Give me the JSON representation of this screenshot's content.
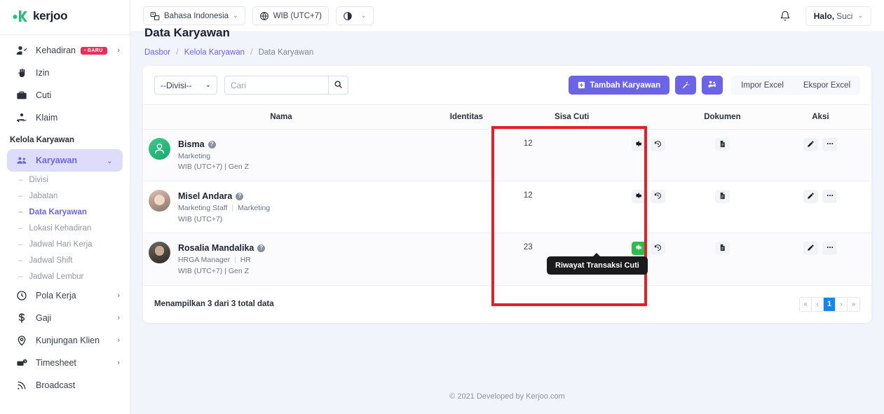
{
  "brand": {
    "name": "kerjoo",
    "accent": "#6b63e8",
    "logo_icon": "kerjoo-leaf-logo"
  },
  "sidebar": {
    "top_items": [
      {
        "label": "Kehadiran",
        "icon": "user-check-icon",
        "badge": "BARU",
        "chevron": "›"
      },
      {
        "label": "Izin",
        "icon": "hand-icon",
        "badge": "",
        "chevron": ""
      },
      {
        "label": "Cuti",
        "icon": "briefcase-icon",
        "badge": "",
        "chevron": ""
      },
      {
        "label": "Klaim",
        "icon": "hand-coin-icon",
        "badge": "",
        "chevron": ""
      }
    ],
    "section_title": "Kelola Karyawan",
    "active_item": {
      "label": "Karyawan",
      "icon": "people-icon",
      "chevron": "⌄"
    },
    "sub_items": [
      {
        "label": "Divisi",
        "selected": false
      },
      {
        "label": "Jabatan",
        "selected": false
      },
      {
        "label": "Data Karyawan",
        "selected": true
      },
      {
        "label": "Lokasi Kehadiran",
        "selected": false
      },
      {
        "label": "Jadwal Hari Kerja",
        "selected": false
      },
      {
        "label": "Jadwal Shift",
        "selected": false
      },
      {
        "label": "Jadwal Lembur",
        "selected": false
      }
    ],
    "bottom_items": [
      {
        "label": "Pola Kerja",
        "icon": "clock-icon",
        "chevron": "›"
      },
      {
        "label": "Gaji",
        "icon": "dollar-icon",
        "chevron": "›"
      },
      {
        "label": "Kunjungan Klien",
        "icon": "map-pin-icon",
        "chevron": "›"
      },
      {
        "label": "Timesheet",
        "icon": "timesheet-icon",
        "chevron": "›"
      },
      {
        "label": "Broadcast",
        "icon": "broadcast-icon",
        "chevron": ""
      }
    ]
  },
  "topbar": {
    "language": {
      "label": "Bahasa Indonesia",
      "icon": "translate-icon",
      "caret": "⌄"
    },
    "timezone": {
      "label": "WIB (UTC+7)",
      "icon": "globe-icon"
    },
    "theme": {
      "icon": "contrast-icon",
      "caret": "⌄"
    },
    "notification_icon": "bell-icon",
    "user": {
      "greeting": "Halo,",
      "name": "Suci",
      "caret": "⌄"
    }
  },
  "page": {
    "title": "Data Karyawan",
    "breadcrumb": [
      {
        "label": "Dasbor",
        "link": true
      },
      {
        "label": "Kelola Karyawan",
        "link": true
      },
      {
        "label": "Data Karyawan",
        "link": false
      }
    ],
    "separator": "/"
  },
  "toolbar": {
    "divisi_value": "--Divisi--",
    "divisi_caret": "⌄",
    "search_placeholder": "Cari",
    "search_value": "",
    "search_icon": "search-icon",
    "add_label": "Tambah Karyawan",
    "add_icon": "plus-square-icon",
    "magic_icon": "magic-wand-icon",
    "bulk_icon": "bulk-users-icon",
    "import_label": "Impor Excel",
    "export_label": "Ekspor Excel"
  },
  "table": {
    "headers": [
      "Nama",
      "Identitas",
      "Sisa Cuti",
      "",
      "Dokumen",
      "Aksi"
    ],
    "rows": [
      {
        "name": "Bisma",
        "role": "Marketing",
        "division": "",
        "timezone": "WIB (UTC+7)",
        "generation": "Gen Z",
        "avatar": "default-user-avatar",
        "identitas": "",
        "sisa_cuti": "12",
        "gear_active": false,
        "gear_icon": "gear-icon",
        "history_icon": "history-icon",
        "document_icon": "document-icon",
        "edit_icon": "pencil-icon",
        "more_icon": "ellipsis-icon"
      },
      {
        "name": "Misel Andara",
        "role": "Marketing Staff",
        "division": "Marketing",
        "timezone": "WIB (UTC+7)",
        "generation": "",
        "avatar": "photo-avatar",
        "identitas": "",
        "sisa_cuti": "12",
        "gear_active": false,
        "gear_icon": "gear-icon",
        "history_icon": "history-icon",
        "document_icon": "document-icon",
        "edit_icon": "pencil-icon",
        "more_icon": "ellipsis-icon"
      },
      {
        "name": "Rosalia Mandalika",
        "role": "HRGA Manager",
        "division": "HR",
        "timezone": "WIB (UTC+7)",
        "generation": "Gen Z",
        "avatar": "photo-avatar",
        "identitas": "",
        "sisa_cuti": "23",
        "gear_active": true,
        "gear_icon": "gear-icon",
        "history_icon": "history-icon",
        "document_icon": "document-icon",
        "edit_icon": "pencil-icon",
        "more_icon": "ellipsis-icon"
      }
    ],
    "info": "Menampilkan 3 dari 3 total data",
    "pagination": {
      "first": "«",
      "prev": "‹",
      "current": "1",
      "next": "›",
      "last": "»"
    }
  },
  "tooltip": {
    "text": "Riwayat Transaksi Cuti"
  },
  "highlight": {
    "color": "#e3202a"
  },
  "footer": {
    "copyright": "© 2021 Developed by Kerjoo.com"
  }
}
